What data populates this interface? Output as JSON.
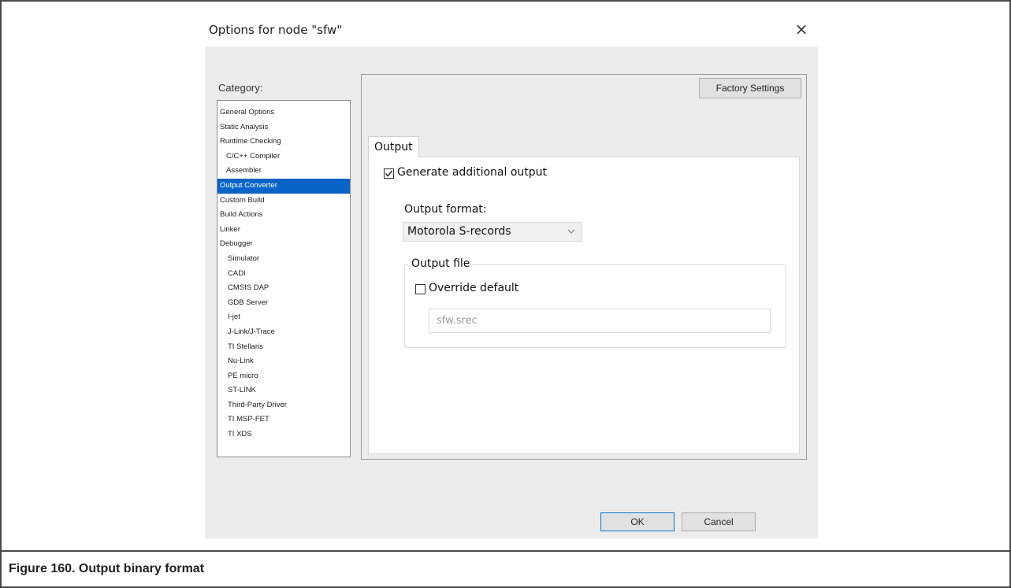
{
  "dialog": {
    "title": "Options for node \"sfw\"",
    "close_glyph": "×"
  },
  "category": {
    "label": "Category:",
    "selected": "Output Converter",
    "items": [
      {
        "label": "General Options",
        "level": 1
      },
      {
        "label": "Static Analysis",
        "level": 1
      },
      {
        "label": "Runtime Checking",
        "level": 1
      },
      {
        "label": "C/C++ Compiler",
        "level": 2
      },
      {
        "label": "Assembler",
        "level": 2
      },
      {
        "label": "Output Converter",
        "level": 1
      },
      {
        "label": "Custom Build",
        "level": 1
      },
      {
        "label": "Build Actions",
        "level": 1
      },
      {
        "label": "Linker",
        "level": 1
      },
      {
        "label": "Debugger",
        "level": 1
      },
      {
        "label": "Simulator",
        "level": 3
      },
      {
        "label": "CADI",
        "level": 3
      },
      {
        "label": "CMSIS DAP",
        "level": 3
      },
      {
        "label": "GDB Server",
        "level": 3
      },
      {
        "label": "I-jet",
        "level": 3
      },
      {
        "label": "J-Link/J-Trace",
        "level": 3
      },
      {
        "label": "TI Stellaris",
        "level": 3
      },
      {
        "label": "Nu-Link",
        "level": 3
      },
      {
        "label": "PE micro",
        "level": 3
      },
      {
        "label": "ST-LINK",
        "level": 3
      },
      {
        "label": "Third-Party Driver",
        "level": 3
      },
      {
        "label": "TI MSP-FET",
        "level": 3
      },
      {
        "label": "TI XDS",
        "level": 3
      }
    ]
  },
  "panel": {
    "factory_settings_label": "Factory Settings",
    "tab_label": "Output",
    "generate_output": {
      "label": "Generate additional output",
      "checked": true
    },
    "output_format": {
      "label": "Output format:",
      "value": "Motorola S-records"
    },
    "output_file": {
      "group_label": "Output file",
      "override": {
        "label": "Override default",
        "checked": false
      },
      "filename": "sfw.srec"
    }
  },
  "buttons": {
    "ok": "OK",
    "cancel": "Cancel"
  },
  "caption": "Figure 160. Output binary format"
}
